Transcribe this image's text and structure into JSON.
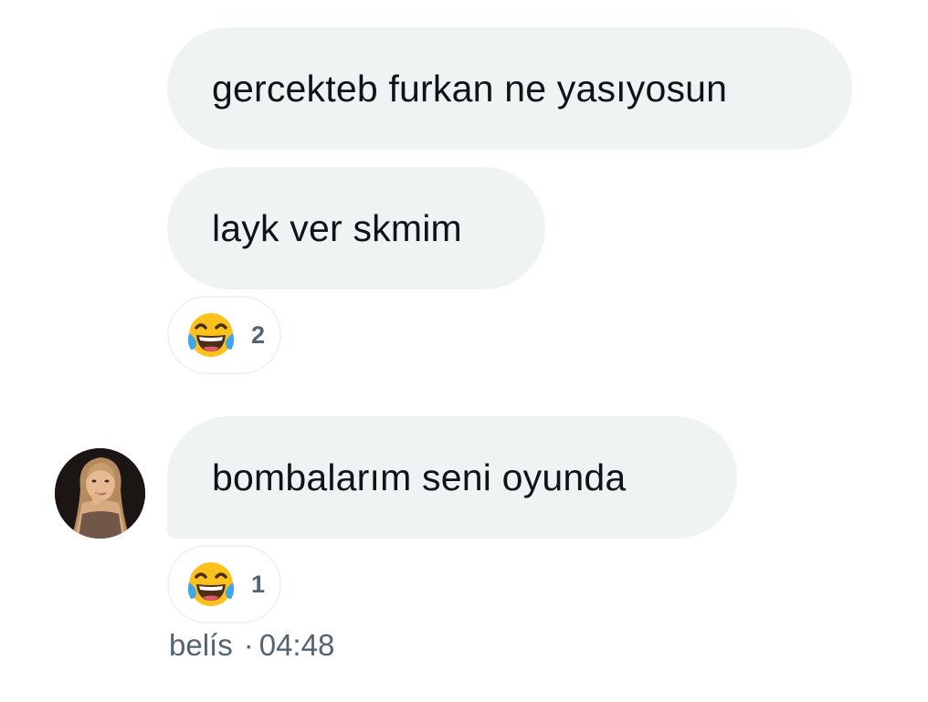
{
  "messages": [
    {
      "text": "gercekteb furkan ne yasıyosun"
    },
    {
      "text": "layk ver skmim",
      "reaction": {
        "emoji_icon": "face-with-tears-of-joy-icon",
        "count": "2"
      }
    },
    {
      "text": "bombalarım seni oyunda",
      "reaction": {
        "emoji_icon": "face-with-tears-of-joy-icon",
        "count": "1"
      }
    }
  ],
  "sender": {
    "name": "belís",
    "separator": "·",
    "time": "04:48",
    "avatar_icon": "user-avatar-photo"
  },
  "colors": {
    "bubble_background": "#eff3f4",
    "text": "#0f1419",
    "secondary_text": "#536471",
    "emoji_face": "#fcc21b",
    "emoji_tears": "#40a6e8"
  }
}
